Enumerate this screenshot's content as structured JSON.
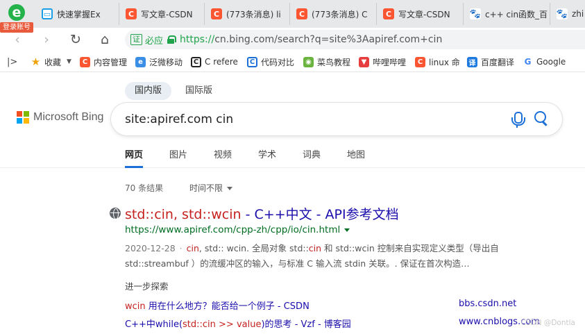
{
  "browser": {
    "login_badge": "登录账号",
    "tabs": [
      {
        "label": "快速掌握Ex",
        "icon": "bilibili-tv-icon"
      },
      {
        "label": "写文章-CSDN",
        "icon": "csdn-icon"
      },
      {
        "label": "(773条消息) li",
        "icon": "csdn-icon"
      },
      {
        "label": "(773条消息) C",
        "icon": "csdn-icon"
      },
      {
        "label": "写文章-CSDN",
        "icon": "csdn-icon"
      },
      {
        "label": "c++ cin函数_百",
        "icon": "baidu-paw-icon"
      },
      {
        "label": "zhi",
        "icon": "baidu-paw-icon"
      }
    ],
    "tab_icon_glyphs": {
      "csdn-icon": "C",
      "bilibili-tv-icon": "▭",
      "baidu-paw-icon": "🐾"
    },
    "address": {
      "cert_label": "证",
      "mode_label": "必应",
      "url_scheme": "https://",
      "url_rest": "cn.bing.com/search?q=site%3Aapiref.com+cin"
    },
    "bookmarks": [
      {
        "label": "收藏",
        "icon": "star-icon",
        "glyph": "★"
      },
      {
        "label": "内容管理",
        "icon": "csdn-icon",
        "glyph": "C"
      },
      {
        "label": "泛微移动",
        "icon": "fanwei-icon",
        "glyph": "e"
      },
      {
        "label": "C refere",
        "icon": "cref-icon",
        "glyph": "C"
      },
      {
        "label": "代码对比",
        "icon": "diff-icon",
        "glyph": "C"
      },
      {
        "label": "菜鸟教程",
        "icon": "runoob-icon",
        "glyph": "◉"
      },
      {
        "label": "哔哩哔哩",
        "icon": "bilibili-icon",
        "glyph": "▼"
      },
      {
        "label": "linux 命",
        "icon": "csdn-icon",
        "glyph": "C"
      },
      {
        "label": "百度翻译",
        "icon": "translate-icon",
        "glyph": "译"
      },
      {
        "label": "Google",
        "icon": "google-icon",
        "glyph": "G"
      }
    ]
  },
  "bing": {
    "region_tabs": [
      "国内版",
      "国际版"
    ],
    "logo_text": "Microsoft Bing",
    "query": "site:apiref.com cin",
    "scopes": [
      "网页",
      "图片",
      "视频",
      "学术",
      "词典",
      "地图"
    ]
  },
  "results": {
    "count": "70 条结果",
    "time_filter": "时间不限",
    "items": [
      {
        "title_pre": "std::cin, std::wcin",
        "title_post": " - C++中文 - API参考文档",
        "url": "https://www.apiref.com/cpp-zh/cpp/io/cin.html",
        "date": "2020-12-28",
        "snippet_parts": [
          "cin",
          ", std:: wcin. 全局对象 std::",
          "cin",
          " 和 std::wcin 控制来自实现定义类型（导出自 std::streambuf ）的流缓冲区的输入，与标准 C 输入流 stdin 关联。. 保证在首次构造…"
        ]
      }
    ],
    "explore_heading": "进一步探索",
    "explore": [
      {
        "query_hl": "wcin",
        "query_rest": " 用在什么地方？能否给一个例子 - CSDN",
        "site": "bbs.csdn.net"
      },
      {
        "query_pre": "C++中while(",
        "query_hl": "std::cin >> value",
        "query_rest": ")的思考 - Vzf - 博客园",
        "site": "www.cnblogs.com"
      }
    ],
    "watermark": "CSDN @Dontla"
  }
}
